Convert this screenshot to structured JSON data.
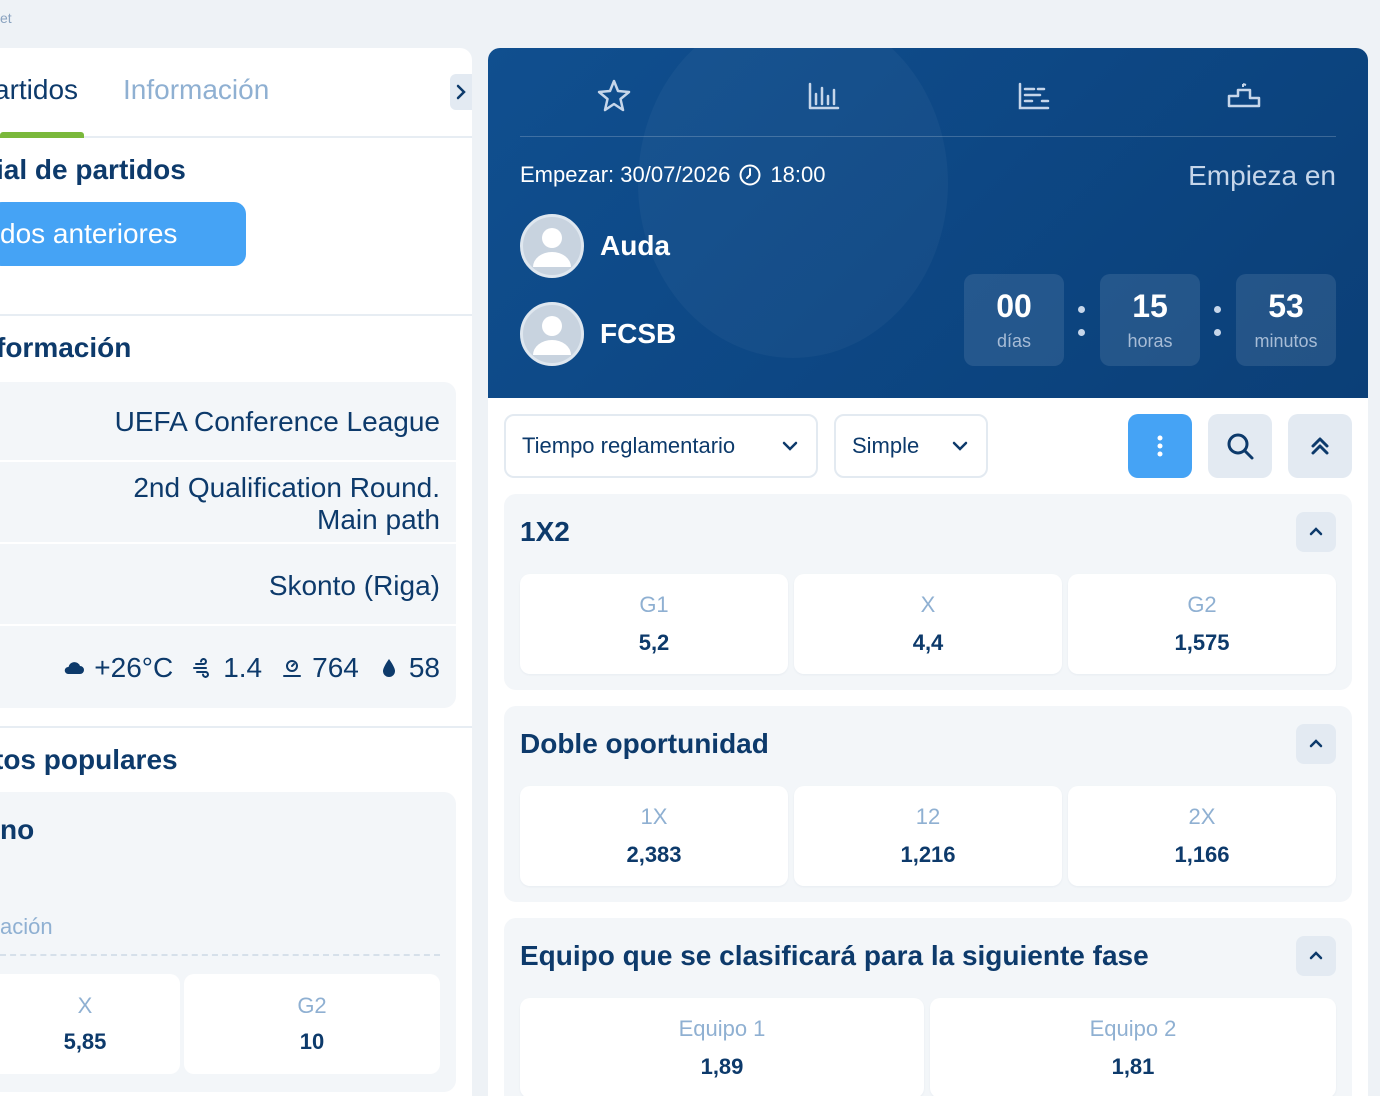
{
  "breadcrumb": "et",
  "left": {
    "tabs": [
      "artidos",
      "Información"
    ],
    "history_title": "ial de partidos",
    "prev_button": "dos anteriores",
    "info_title": "formación",
    "info": {
      "tournament": "UEFA Conference League",
      "round_line1": "2nd Qualification Round.",
      "round_line2": "Main path",
      "stadium": "Skonto (Riga)",
      "weather": {
        "temp": "+26°C",
        "wind": "1.4",
        "pressure": "764",
        "humidity": "58"
      }
    },
    "popular_title": "tos populares",
    "popular": {
      "market": "no",
      "sub": "ación",
      "odds": [
        {
          "label": "X",
          "value": "5,85"
        },
        {
          "label": "G2",
          "value": "10"
        }
      ]
    }
  },
  "hero": {
    "icons": [
      "star-icon",
      "stats-icon",
      "lineup-icon",
      "podium-icon"
    ],
    "start_label": "Empezar: 30/07/2026",
    "start_time": "18:00",
    "starts_in": "Empieza en",
    "team1": "Auda",
    "team2": "FCSB",
    "countdown": [
      {
        "value": "00",
        "unit": "días"
      },
      {
        "value": "15",
        "unit": "horas"
      },
      {
        "value": "53",
        "unit": "minutos"
      }
    ]
  },
  "filters": {
    "period": "Tiempo reglamentario",
    "mode": "Simple"
  },
  "markets": [
    {
      "title": "1X2",
      "odds": [
        {
          "label": "G1",
          "value": "5,2"
        },
        {
          "label": "X",
          "value": "4,4"
        },
        {
          "label": "G2",
          "value": "1,575"
        }
      ]
    },
    {
      "title": "Doble oportunidad",
      "odds": [
        {
          "label": "1X",
          "value": "2,383"
        },
        {
          "label": "12",
          "value": "1,216"
        },
        {
          "label": "2X",
          "value": "1,166"
        }
      ]
    },
    {
      "title": "Equipo que se clasificará para la siguiente fase",
      "odds": [
        {
          "label": "Equipo 1",
          "value": "1,89"
        },
        {
          "label": "Equipo 2",
          "value": "1,81"
        }
      ]
    }
  ],
  "colors": {
    "primary": "#0d3a6b",
    "accent_blue": "#45a3f5",
    "accent_green": "#7ab83b",
    "hero_bg": "#0d4784"
  }
}
